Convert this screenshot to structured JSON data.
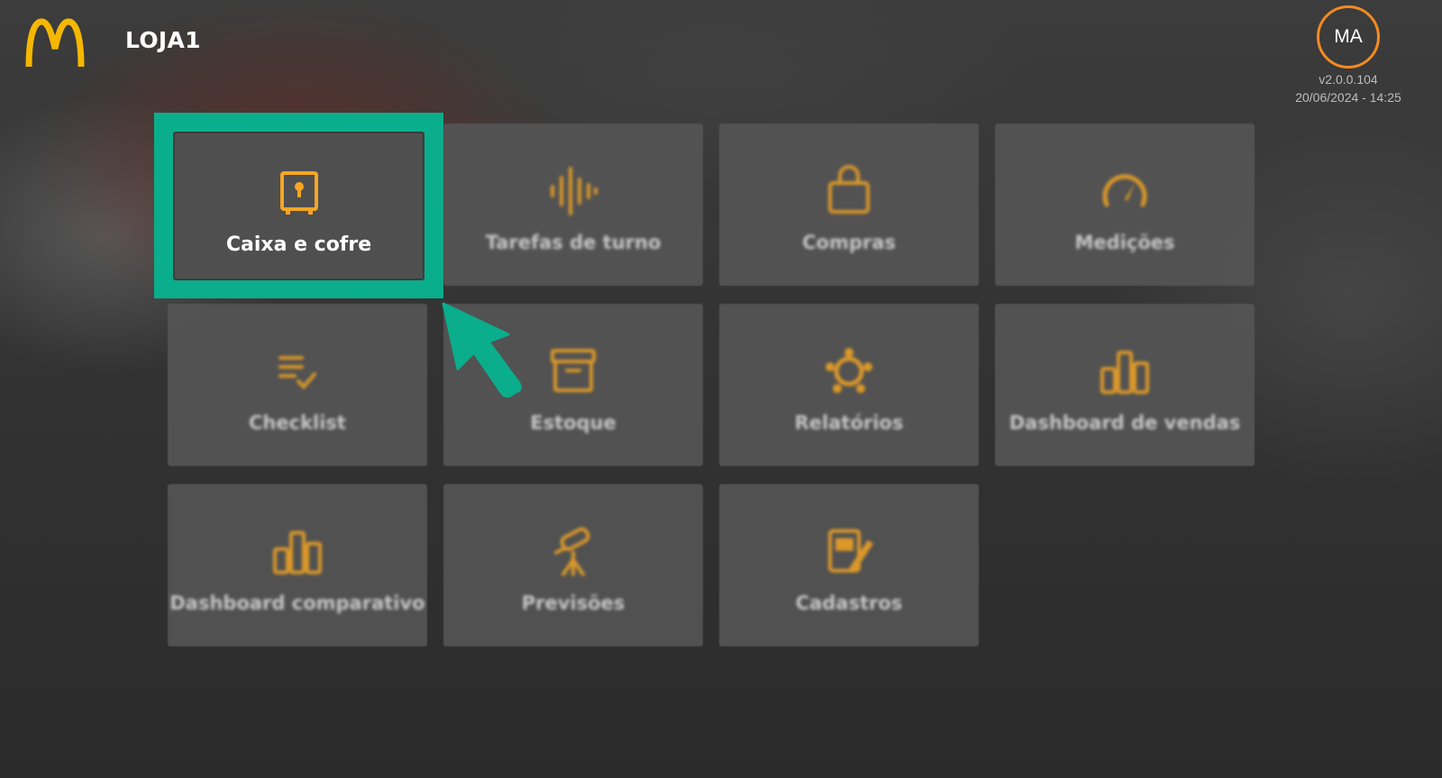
{
  "header": {
    "store_name": "LOJA1",
    "logo_icon": "mcdonalds-arches-logo"
  },
  "user": {
    "initials": "MA",
    "version": "v2.0.0.104",
    "datetime": "20/06/2024 - 14:25"
  },
  "colors": {
    "accent": "#f5a623",
    "avatar_ring": "#f28b23",
    "highlight": "#0aae8c"
  },
  "tiles": [
    {
      "label": "Caixa e cofre",
      "icon": "safe-icon",
      "highlighted": true
    },
    {
      "label": "Tarefas de turno",
      "icon": "sound-wave-icon"
    },
    {
      "label": "Compras",
      "icon": "shopping-bag-icon"
    },
    {
      "label": "Medições",
      "icon": "speedometer-icon"
    },
    {
      "label": "Checklist",
      "icon": "checklist-icon"
    },
    {
      "label": "Estoque",
      "icon": "archive-box-icon"
    },
    {
      "label": "Relatórios",
      "icon": "network-icon"
    },
    {
      "label": "Dashboard de vendas",
      "icon": "bar-chart-icon"
    },
    {
      "label": "Dashboard comparativo",
      "icon": "bar-chart-icon"
    },
    {
      "label": "Previsões",
      "icon": "telescope-icon"
    },
    {
      "label": "Cadastros",
      "icon": "edit-document-icon"
    }
  ],
  "annotation": {
    "pointer_icon": "cursor-arrow-icon"
  }
}
